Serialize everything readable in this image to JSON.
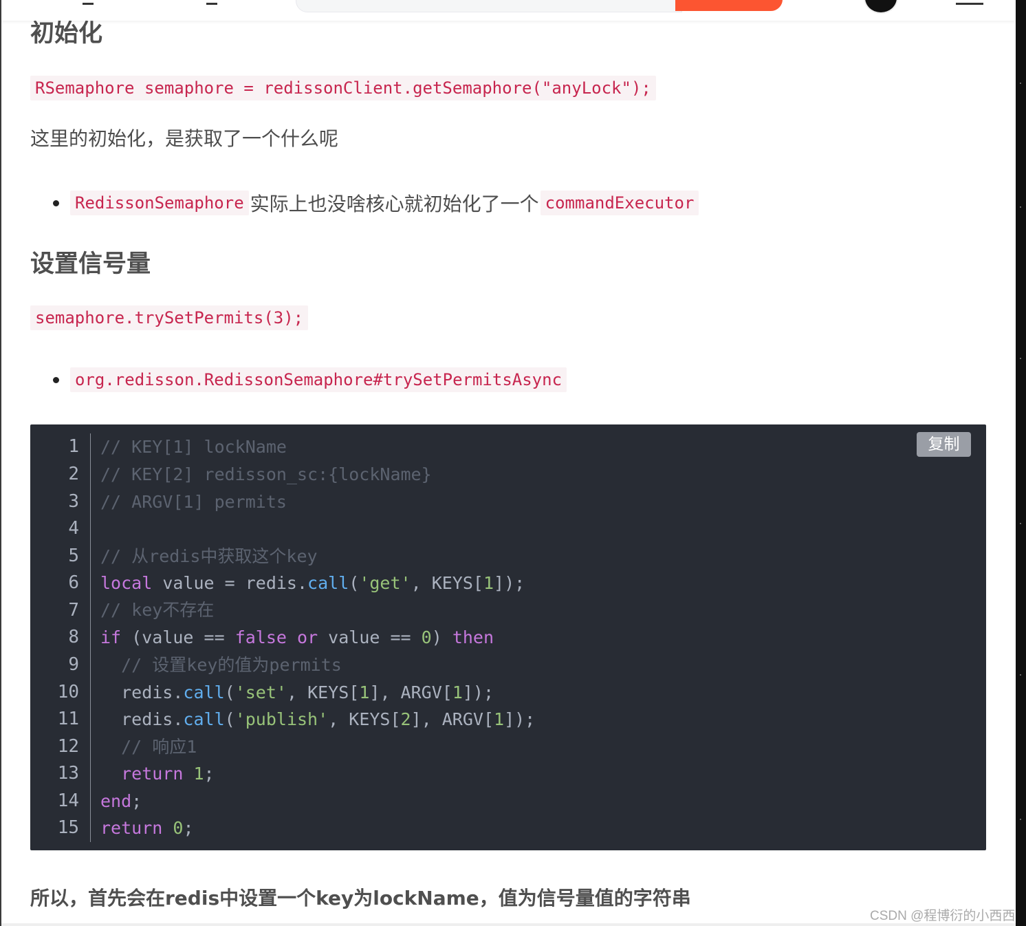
{
  "sections": {
    "init": {
      "heading": "初始化",
      "code": "RSemaphore semaphore = redissonClient.getSemaphore(\"anyLock\");",
      "question": "这里的初始化，是获取了一个什么呢",
      "bullet": {
        "code_a": "RedissonSemaphore",
        "text": "实际上也没啥核心就初始化了一个",
        "code_b": "commandExecutor"
      }
    },
    "set_permits": {
      "heading": "设置信号量",
      "code": "semaphore.trySetPermits(3);",
      "bullet_code": "org.redisson.RedissonSemaphore#trySetPermitsAsync"
    }
  },
  "code_block": {
    "copy_label": "复制",
    "line_numbers": [
      "1",
      "2",
      "3",
      "4",
      "5",
      "6",
      "7",
      "8",
      "9",
      "10",
      "11",
      "12",
      "13",
      "14",
      "15"
    ],
    "tokens": {
      "l1_c": "// ",
      "l1_t": "KEY[1] lockName",
      "l2_c": "// ",
      "l2_t": "KEY[2] redisson_sc:{lockName}",
      "l3_c": "// ",
      "l3_t": "ARGV[1] permits",
      "l5_c": "// ",
      "l5_t": "从redis中获取这个key",
      "l6_local": "local",
      "l6_mid": " value = redis.",
      "l6_call": "call",
      "l6_p": "(",
      "l6_str": "'get'",
      "l6_rest": ", KEYS[",
      "l6_n": "1",
      "l6_end": "]);",
      "l7_c": "// ",
      "l7_t": "key不存在",
      "l8_if": "if",
      "l8_a": " (value == ",
      "l8_false": "false",
      "l8_sp": " ",
      "l8_or": "or",
      "l8_b": " value == ",
      "l8_n": "0",
      "l8_c": ") ",
      "l8_then": "then",
      "l9_c": "  // ",
      "l9_t": "设置key的值为permits",
      "l10_a": "  redis.",
      "l10_call": "call",
      "l10_p": "(",
      "l10_str": "'set'",
      "l10_b": ", KEYS[",
      "l10_n1": "1",
      "l10_c": "], ARGV[",
      "l10_n2": "1",
      "l10_d": "]);",
      "l11_a": "  redis.",
      "l11_call": "call",
      "l11_p": "(",
      "l11_str": "'publish'",
      "l11_b": ", KEYS[",
      "l11_n1": "2",
      "l11_c": "], ARGV[",
      "l11_n2": "1",
      "l11_d": "]);",
      "l12_c": "  // ",
      "l12_t": "响应1",
      "l13_sp": "  ",
      "l13_kw": "return",
      "l13_sp2": " ",
      "l13_n": "1",
      "l13_e": ";",
      "l14_kw": "end",
      "l14_e": ";",
      "l15_kw": "return",
      "l15_sp": " ",
      "l15_n": "0",
      "l15_e": ";"
    }
  },
  "summary": "所以，首先会在redis中设置一个key为lockName，值为信号量值的字符串",
  "watermark": "CSDN @程博衍的小西西"
}
